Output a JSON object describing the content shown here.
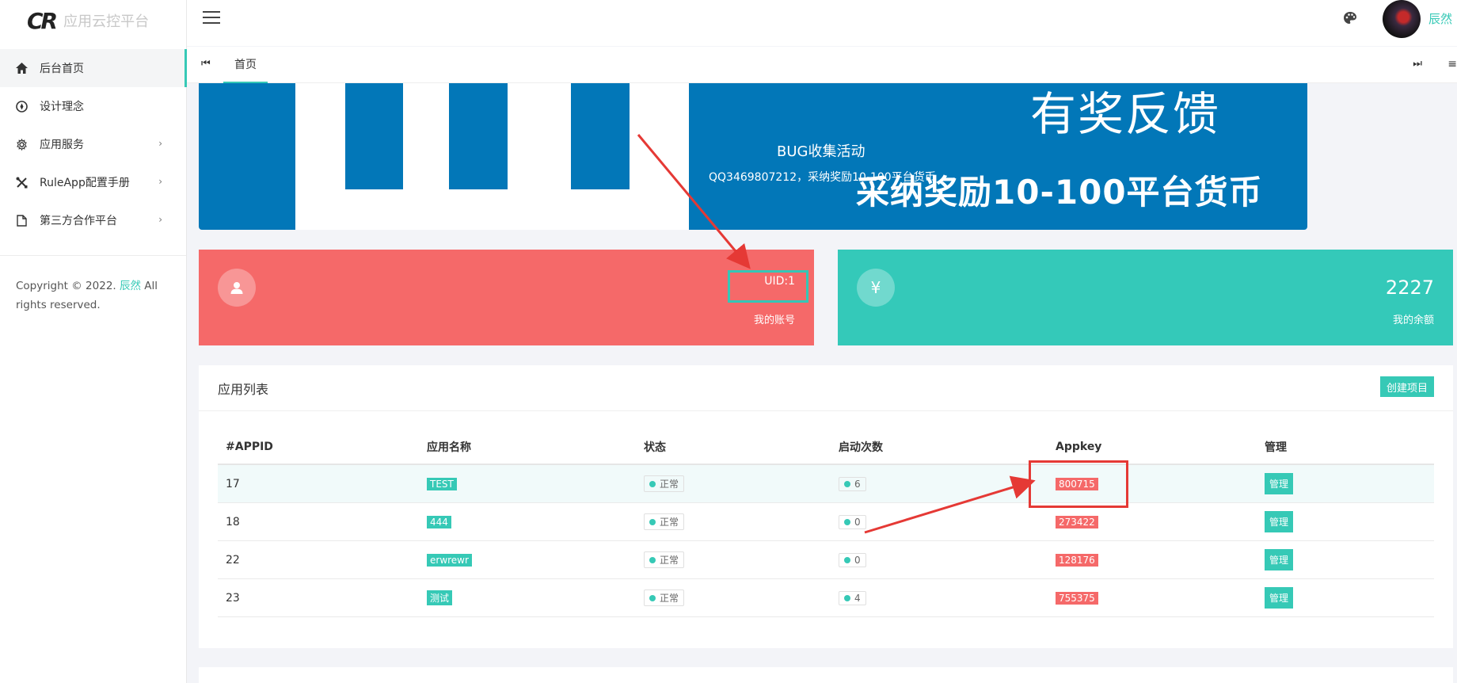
{
  "brand": {
    "logo": "CR",
    "name": "应用云控平台"
  },
  "sidebar": {
    "items": [
      {
        "label": "后台首页",
        "icon": "home-icon"
      },
      {
        "label": "设计理念",
        "icon": "compass-icon"
      },
      {
        "label": "应用服务",
        "icon": "gear-icon",
        "arrow": "›"
      },
      {
        "label": "RuleApp配置手册",
        "icon": "tools-icon",
        "arrow": "›"
      },
      {
        "label": "第三方合作平台",
        "icon": "document-icon",
        "arrow": "›"
      }
    ],
    "copyright_prefix": "Copyright © 2022.",
    "copyright_author": "辰然",
    "copyright_suffix": "All rights reserved."
  },
  "header": {
    "username": "辰然"
  },
  "tabs": {
    "prev": "⏮",
    "home": "首页",
    "next": "⏭",
    "menu": "≡"
  },
  "banner": {
    "big_text": "有奖反馈",
    "sub_text": "采纳奖励10-100平台货币",
    "title": "BUG收集活动",
    "desc": "QQ3469807212，采纳奖励10-100平台货币"
  },
  "cards": {
    "account": {
      "icon": "user-icon",
      "value": "UID:1",
      "label": "我的账号"
    },
    "balance": {
      "icon": "yen-icon",
      "icon_glyph": "¥",
      "value": "2227",
      "label": "我的余额"
    }
  },
  "app_list": {
    "title": "应用列表",
    "create_label": "创建项目",
    "columns": [
      "#APPID",
      "应用名称",
      "状态",
      "启动次数",
      "Appkey",
      "管理"
    ],
    "rows": [
      {
        "appid": "17",
        "name": "TEST",
        "status": "正常",
        "launches": "6",
        "appkey": "800715",
        "manage": "管理"
      },
      {
        "appid": "18",
        "name": "444",
        "status": "正常",
        "launches": "0",
        "appkey": "273422",
        "manage": "管理"
      },
      {
        "appid": "22",
        "name": "erwrewr",
        "status": "正常",
        "launches": "0",
        "appkey": "128176",
        "manage": "管理"
      },
      {
        "appid": "23",
        "name": "测试",
        "status": "正常",
        "launches": "4",
        "appkey": "755375",
        "manage": "管理"
      }
    ]
  },
  "colors": {
    "accent": "#36c9b6",
    "danger": "#f56969",
    "banner": "#0277b8",
    "annotation": "#e53935"
  }
}
